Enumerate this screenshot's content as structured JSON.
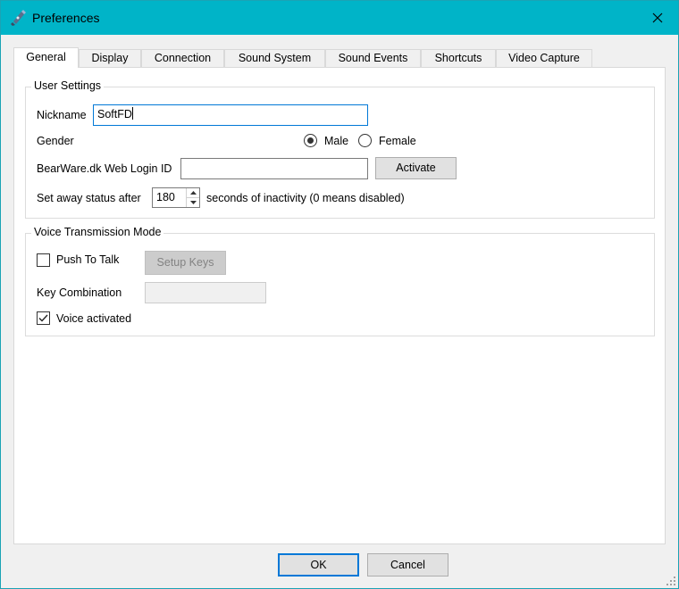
{
  "window": {
    "title": "Preferences",
    "accent_color": "#00b4c8",
    "icon": "headset-icon"
  },
  "tabs": [
    {
      "label": "General",
      "active": true
    },
    {
      "label": "Display"
    },
    {
      "label": "Connection"
    },
    {
      "label": "Sound System"
    },
    {
      "label": "Sound Events"
    },
    {
      "label": "Shortcuts"
    },
    {
      "label": "Video Capture"
    }
  ],
  "user_settings": {
    "legend": "User Settings",
    "nickname_label": "Nickname",
    "nickname_value": "SoftFD",
    "gender_label": "Gender",
    "gender_options": [
      "Male",
      "Female"
    ],
    "gender_selected": "Male",
    "web_login_label": "BearWare.dk Web Login ID",
    "web_login_value": "",
    "activate_button": "Activate",
    "away_label_prefix": "Set away status after",
    "away_value": "180",
    "away_label_suffix": "seconds of inactivity (0 means disabled)"
  },
  "voice_mode": {
    "legend": "Voice Transmission Mode",
    "push_to_talk_label": "Push To Talk",
    "push_to_talk_checked": false,
    "setup_keys_button": "Setup Keys",
    "key_combination_label": "Key Combination",
    "key_combination_value": "",
    "voice_activated_label": "Voice activated",
    "voice_activated_checked": true
  },
  "footer": {
    "ok_button": "OK",
    "cancel_button": "Cancel"
  }
}
